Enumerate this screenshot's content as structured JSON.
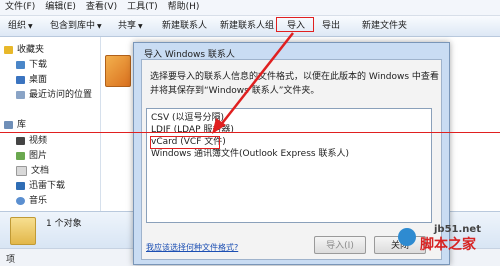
{
  "menu": [
    "文件(F)",
    "编辑(E)",
    "查看(V)",
    "工具(T)",
    "帮助(H)"
  ],
  "toolbar": {
    "organize": "组织",
    "include_in_library": "包含到库中",
    "share": "共享",
    "new_contact": "新建联系人",
    "new_contact_group": "新建联系人组",
    "import": "导入",
    "export": "导出",
    "new_folder": "新建文件夹"
  },
  "nav": {
    "favorites": "收藏夹",
    "downloads": "下载",
    "desktop": "桌面",
    "recent": "最近访问的位置",
    "libraries": "库",
    "videos": "视频",
    "pictures": "图片",
    "documents": "文档",
    "thunder": "迅雷下载",
    "music": "音乐"
  },
  "details": {
    "count": "1 个对象"
  },
  "status": {
    "label": "项"
  },
  "dialog": {
    "title": "导入 Windows 联系人",
    "description": "选择要导入的联系人信息的文件格式，以便在此版本的 Windows 中查看并将其保存到“Windows 联系人”文件夹。",
    "options": [
      "CSV (以逗号分隔)",
      "LDIF (LDAP 服务器)",
      "vCard (VCF 文件)",
      "Windows 通讯簿文件(Outlook Express 联系人)"
    ],
    "help_link": "我应该选择何种文件格式?",
    "import_button": "导入(I)",
    "close_button": "关闭"
  },
  "watermark": {
    "site": "jb51.net",
    "name": "脚本之家"
  },
  "colors": {
    "highlight": "#e02020",
    "arrow": "#e02020",
    "link": "#1c4fb3"
  }
}
